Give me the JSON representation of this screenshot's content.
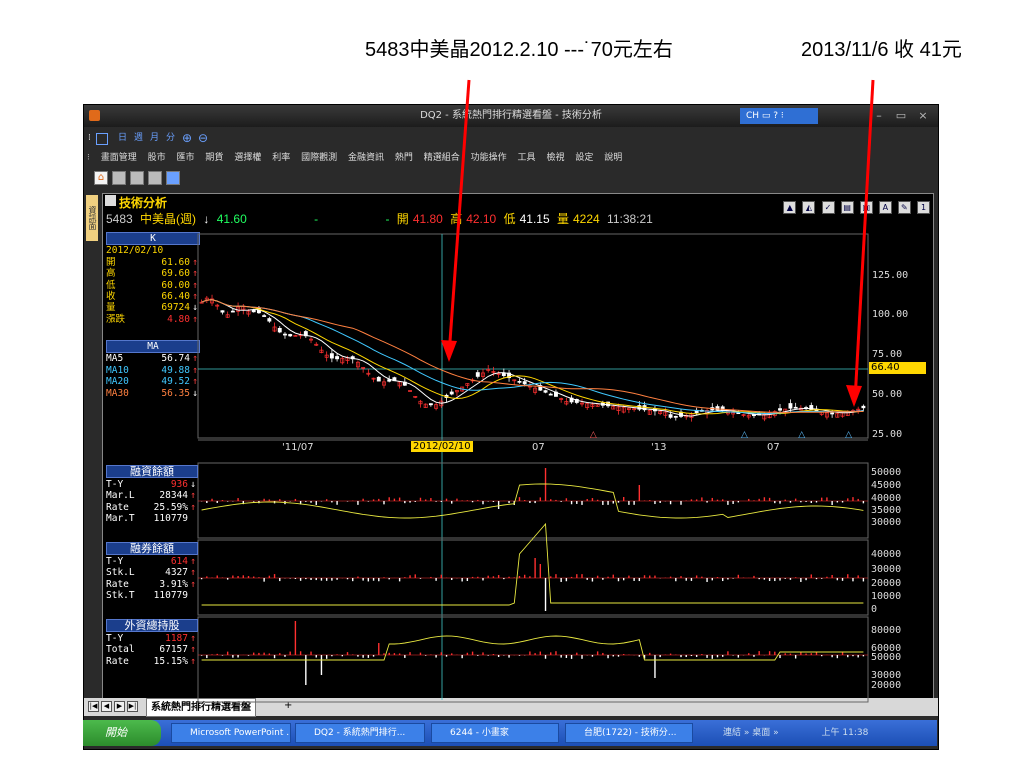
{
  "annotations": {
    "left": "5483中美晶2012.2.10 ---˙70元左右",
    "right": "2013/11/6 收 41元"
  },
  "window": {
    "title": "DQ2 - 系統熱門排行精選看盤 - 技術分析",
    "ime": "CH"
  },
  "toolbar1": [
    "日",
    "週",
    "月",
    "分"
  ],
  "menu": [
    "畫面管理",
    "股市",
    "匯市",
    "期貨",
    "選擇權",
    "利率",
    "國際觀測",
    "金融資訊",
    "熱門",
    "精選組合",
    "功能操作",
    "工具",
    "檢視",
    "設定",
    "說明"
  ],
  "side_tab": "資訊面",
  "panel": {
    "title": "技術分析",
    "buttons": [
      "A",
      "1"
    ]
  },
  "quote": {
    "code": "5483",
    "name": "中美晶(週)",
    "arrow": "↓",
    "price": "41.60",
    "dash1": "-",
    "dash2": "-",
    "open_label": "開",
    "open": "41.80",
    "high_label": "高",
    "high": "42.10",
    "low_label": "低",
    "low": "41.15",
    "vol_label": "量",
    "vol": "4224",
    "time": "11:38:21"
  },
  "k_box": {
    "title": "K",
    "date": "2012/02/10",
    "rows": [
      {
        "label": "開",
        "value": "61.60"
      },
      {
        "label": "高",
        "value": "69.60"
      },
      {
        "label": "低",
        "value": "60.00"
      },
      {
        "label": "收",
        "value": "66.40"
      },
      {
        "label": "量",
        "value": "69724"
      },
      {
        "label": "漲跌",
        "value": "4.80"
      }
    ]
  },
  "ma_box": {
    "title": "MA",
    "rows": [
      {
        "label": "MA5",
        "value": "56.74"
      },
      {
        "label": "MA10",
        "value": "49.88"
      },
      {
        "label": "MA20",
        "value": "49.52"
      },
      {
        "label": "MA30",
        "value": "56.35"
      }
    ]
  },
  "price_axis": [
    "125.00",
    "100.00",
    "75.00",
    "50.00",
    "25.00"
  ],
  "cursor_price": "66.40",
  "x_axis": [
    "'11/07",
    "2012/02/10",
    "07",
    "'13",
    "07"
  ],
  "sub1": {
    "title": "融資餘額",
    "rows": [
      {
        "label": "T-Y",
        "value": "936",
        "dir": "dn"
      },
      {
        "label": "Mar.L",
        "value": "28344",
        "dir": "up"
      },
      {
        "label": "Rate",
        "value": "25.59%",
        "dir": "up"
      },
      {
        "label": "Mar.T",
        "value": "110779",
        "dir": ""
      }
    ],
    "axis": [
      "50000",
      "45000",
      "40000",
      "35000",
      "30000"
    ]
  },
  "sub2": {
    "title": "融券餘額",
    "rows": [
      {
        "label": "T-Y",
        "value": "614",
        "dir": "up"
      },
      {
        "label": "Stk.L",
        "value": "4327",
        "dir": "up"
      },
      {
        "label": "Rate",
        "value": "3.91%",
        "dir": "up"
      },
      {
        "label": "Stk.T",
        "value": "110779",
        "dir": ""
      }
    ],
    "axis": [
      "40000",
      "30000",
      "20000",
      "10000",
      "0"
    ]
  },
  "sub3": {
    "title": "外資總持股",
    "rows": [
      {
        "label": "T-Y",
        "value": "1187",
        "dir": "up"
      },
      {
        "label": "Total",
        "value": "67157",
        "dir": "up"
      },
      {
        "label": "Rate",
        "value": "15.15%",
        "dir": "up"
      }
    ],
    "axis": [
      "80000",
      "60000",
      "50000",
      "30000",
      "20000"
    ]
  },
  "sheet_tab": "系統熱門排行精選看盤",
  "taskbar": {
    "start": "開始",
    "items": [
      "Microsoft PowerPoint ...",
      "DQ2 - 系統熱門排行...",
      "6244 - 小畫家",
      "台肥(1722) - 技術分..."
    ],
    "tray": [
      "連結",
      "桌面"
    ],
    "clock": "上午 11:38"
  },
  "colors": {
    "up": "#ff3030",
    "down": "#ffffff",
    "ma5": "#ffffff",
    "ma10": "#ffd700",
    "ma20": "#40c8ff",
    "ma30": "#ff8040",
    "accent": "#ffd700"
  }
}
